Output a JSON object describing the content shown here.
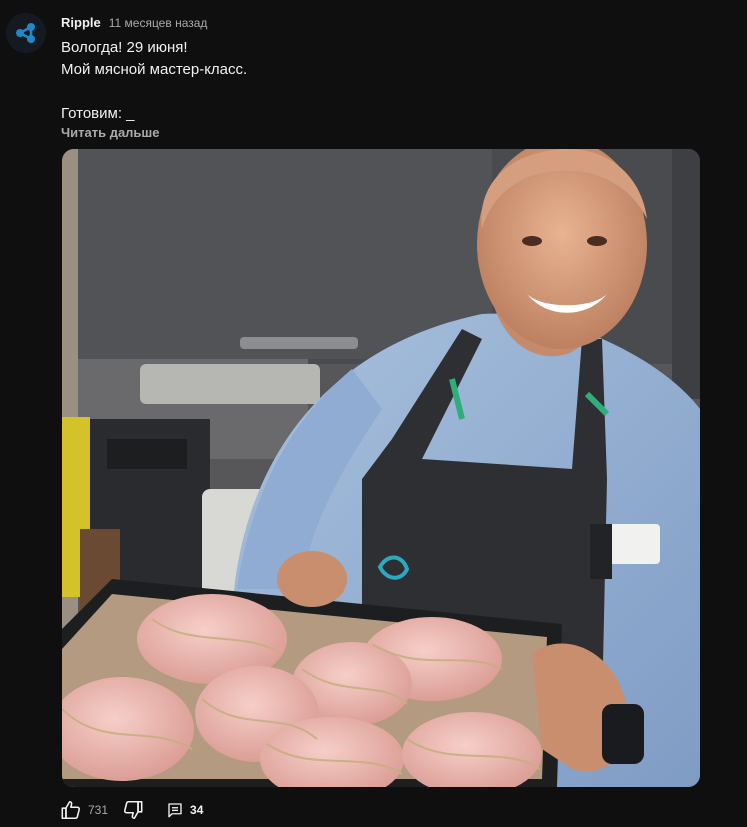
{
  "post": {
    "channel_name": "Ripple",
    "time": "11 месяцев назад",
    "text_lines": [
      "Вологда! 29 июня!",
      "Мой мясной мастер-класс.",
      "",
      "Готовим: _"
    ],
    "read_more": "Читать дальше"
  },
  "image": {
    "subject": "smiling chef in apron holding tray of raw poultry"
  },
  "actions": {
    "like_count": "731",
    "comment_count": "34"
  },
  "colors": {
    "background": "#0f0f0f",
    "text_primary": "#f1f1f1",
    "text_secondary": "#aaaaaa",
    "avatar_accent": "#1e88c8"
  },
  "icons": {
    "avatar": "ripple-logo-icon",
    "like": "thumbs-up-icon",
    "dislike": "thumbs-down-icon",
    "comments": "comment-icon"
  }
}
